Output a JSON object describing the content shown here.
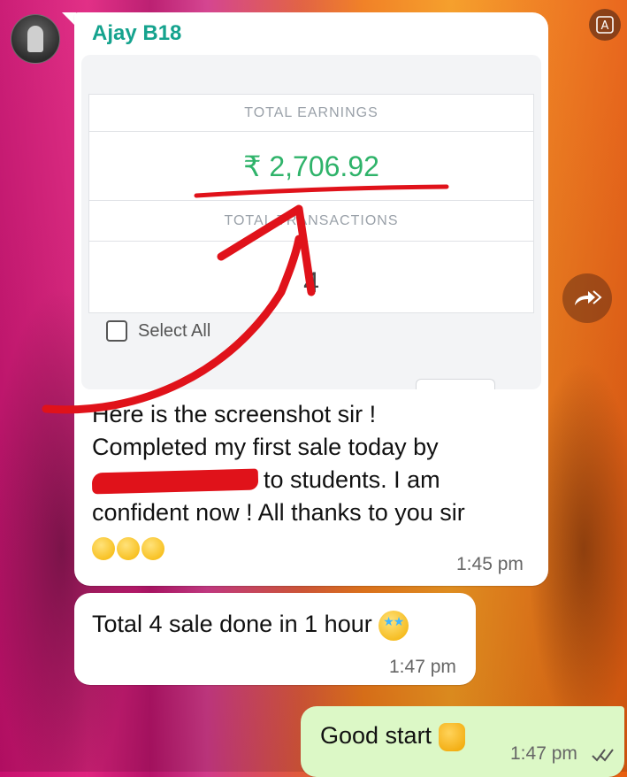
{
  "chat": {
    "sender_name": "Ajay B18",
    "message1": {
      "screenshot": {
        "total_earnings_label": "TOTAL EARNINGS",
        "total_earnings_value": "₹ 2,706.92",
        "total_transactions_label": "TOTAL TRANSACTIONS",
        "total_transactions_value": "4",
        "select_all_label": "Select All"
      },
      "lines": [
        "Here is the screenshot sir !",
        "Completed my first sale today by",
        "to students. I am",
        "confident now ! All thanks to you sir"
      ],
      "time": "1:45 pm"
    },
    "message2": {
      "text": "Total 4 sale done in 1 hour",
      "time": "1:47 pm"
    },
    "message3": {
      "text": "Good start",
      "time": "1:47 pm"
    }
  },
  "icons": {
    "translate": "translate-icon",
    "forward": "forward-icon",
    "read_receipt": "double-check-icon"
  },
  "colors": {
    "sender": "#15a38e",
    "amount": "#2fb36a",
    "annotation_red": "#e0121a",
    "outgoing_bubble": "#dcf8c6"
  }
}
